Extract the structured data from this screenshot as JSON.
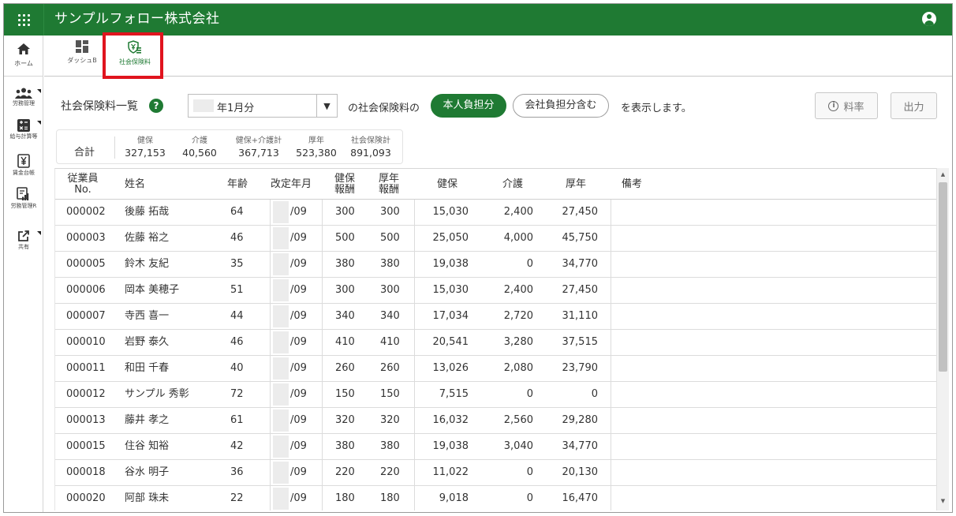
{
  "header": {
    "company": "サンプルフォロー株式会社"
  },
  "rail": {
    "home": "ホーム",
    "items": [
      {
        "label": "労務管理",
        "icon": "people-icon"
      },
      {
        "label": "給与計算等",
        "icon": "calculator-icon"
      },
      {
        "label": "賃金台帳",
        "icon": "yen-ledger-icon"
      },
      {
        "label": "労務管理R",
        "icon": "report-icon"
      },
      {
        "label": "共有",
        "icon": "share-icon"
      }
    ]
  },
  "subbar": {
    "tabs": [
      {
        "label": "ダッシュB",
        "icon": "dashboard-icon",
        "active": false
      },
      {
        "label": "社会保険料",
        "icon": "insurance-shield-icon",
        "active": true
      }
    ]
  },
  "controls": {
    "title": "社会保険料一覧",
    "help": "?",
    "month_value": "年1月分",
    "month_arrow": "▼",
    "text_of": "の社会保険料の",
    "pill_self": "本人負担分",
    "pill_company": "会社負担分含む",
    "text_display": "を表示します。",
    "rate_button": "料率",
    "info_glyph": "i",
    "export_button": "出力"
  },
  "totals": {
    "label": "合計",
    "columns": [
      {
        "header": "健保",
        "value": "327,153"
      },
      {
        "header": "介護",
        "value": "40,560"
      },
      {
        "header": "健保+介護計",
        "value": "367,713"
      },
      {
        "header": "厚年",
        "value": "523,380"
      },
      {
        "header": "社会保険計",
        "value": "891,093"
      }
    ]
  },
  "table": {
    "headers": {
      "emp_no_1": "従業員",
      "emp_no_2": "No.",
      "name": "姓名",
      "age": "年齢",
      "revised": "改定年月",
      "kenpo_rem_1": "健保",
      "kenpo_rem_2": "報酬",
      "kosei_rem_1": "厚年",
      "kosei_rem_2": "報酬",
      "kenpo": "健保",
      "kaigo": "介護",
      "kosei": "厚年",
      "note": "備考"
    },
    "rows": [
      {
        "no": "000002",
        "name": "後藤 拓哉",
        "age": "64",
        "revised": "/09",
        "kenpo_rem": "300",
        "kosei_rem": "300",
        "kenpo": "15,030",
        "kaigo": "2,400",
        "kosei": "27,450"
      },
      {
        "no": "000003",
        "name": "佐藤 裕之",
        "age": "46",
        "revised": "/09",
        "kenpo_rem": "500",
        "kosei_rem": "500",
        "kenpo": "25,050",
        "kaigo": "4,000",
        "kosei": "45,750"
      },
      {
        "no": "000005",
        "name": "鈴木 友紀",
        "age": "35",
        "revised": "/09",
        "kenpo_rem": "380",
        "kosei_rem": "380",
        "kenpo": "19,038",
        "kaigo": "0",
        "kosei": "34,770"
      },
      {
        "no": "000006",
        "name": "岡本 美穂子",
        "age": "51",
        "revised": "/09",
        "kenpo_rem": "300",
        "kosei_rem": "300",
        "kenpo": "15,030",
        "kaigo": "2,400",
        "kosei": "27,450"
      },
      {
        "no": "000007",
        "name": "寺西 喜一",
        "age": "44",
        "revised": "/09",
        "kenpo_rem": "340",
        "kosei_rem": "340",
        "kenpo": "17,034",
        "kaigo": "2,720",
        "kosei": "31,110"
      },
      {
        "no": "000010",
        "name": "岩野 泰久",
        "age": "46",
        "revised": "/09",
        "kenpo_rem": "410",
        "kosei_rem": "410",
        "kenpo": "20,541",
        "kaigo": "3,280",
        "kosei": "37,515"
      },
      {
        "no": "000011",
        "name": "和田 千春",
        "age": "40",
        "revised": "/09",
        "kenpo_rem": "260",
        "kosei_rem": "260",
        "kenpo": "13,026",
        "kaigo": "2,080",
        "kosei": "23,790"
      },
      {
        "no": "000012",
        "name": "サンプル 秀彰",
        "age": "72",
        "revised": "/09",
        "kenpo_rem": "150",
        "kosei_rem": "150",
        "kenpo": "7,515",
        "kaigo": "0",
        "kosei": "0"
      },
      {
        "no": "000013",
        "name": "藤井 孝之",
        "age": "61",
        "revised": "/09",
        "kenpo_rem": "320",
        "kosei_rem": "320",
        "kenpo": "16,032",
        "kaigo": "2,560",
        "kosei": "29,280"
      },
      {
        "no": "000015",
        "name": "住谷 知裕",
        "age": "42",
        "revised": "/09",
        "kenpo_rem": "380",
        "kosei_rem": "380",
        "kenpo": "19,038",
        "kaigo": "3,040",
        "kosei": "34,770"
      },
      {
        "no": "000018",
        "name": "谷水 明子",
        "age": "36",
        "revised": "/09",
        "kenpo_rem": "220",
        "kosei_rem": "220",
        "kenpo": "11,022",
        "kaigo": "0",
        "kosei": "20,130"
      },
      {
        "no": "000020",
        "name": "阿部 珠未",
        "age": "22",
        "revised": "/09",
        "kenpo_rem": "180",
        "kosei_rem": "180",
        "kenpo": "9,018",
        "kaigo": "0",
        "kosei": "16,470"
      }
    ]
  },
  "colors": {
    "brand": "#1f7a33",
    "highlight": "#e0141e"
  }
}
